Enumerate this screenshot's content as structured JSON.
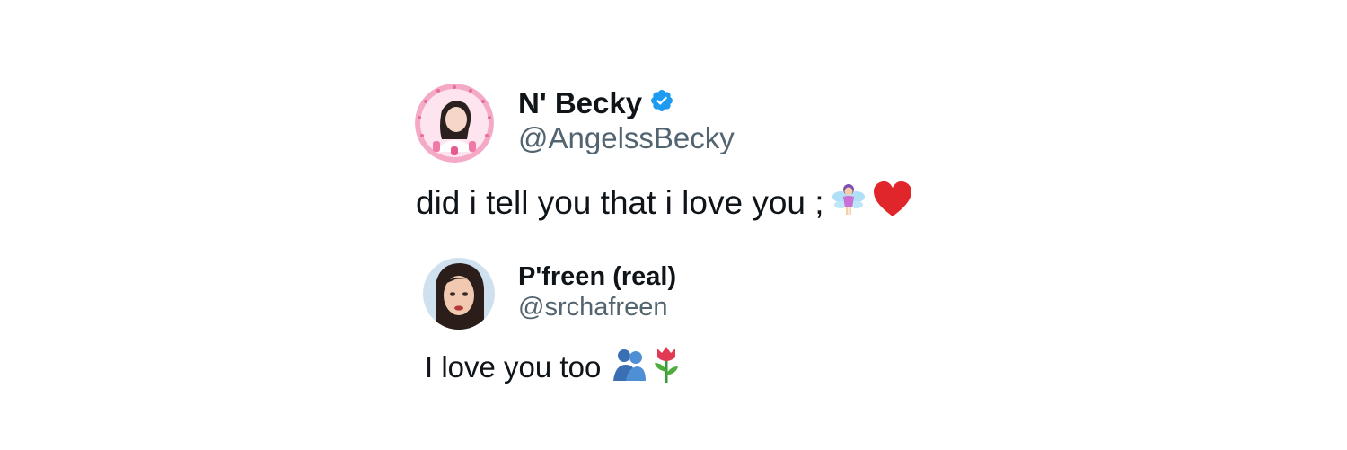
{
  "tweets": [
    {
      "display_name": "N' Becky",
      "handle": "@AngelssBecky",
      "verified": true,
      "text": "did i tell you that i love you ;",
      "emojis": [
        "fairy-emoji",
        "red-heart-emoji"
      ],
      "avatar_colors": {
        "ring": "#f3a6c2",
        "bg": "#fbe3ee"
      }
    },
    {
      "display_name": "P'freen (real)",
      "handle": "@srchafreen",
      "verified": false,
      "text": "I love you too",
      "emojis": [
        "people-hugging-emoji",
        "tulip-emoji"
      ],
      "avatar_colors": {
        "bg": "#cfe0ef"
      }
    }
  ],
  "colors": {
    "verified_blue": "#1d9bf0",
    "handle_gray": "#536471",
    "text_black": "#0f1419",
    "heart_red": "#e0262b"
  }
}
